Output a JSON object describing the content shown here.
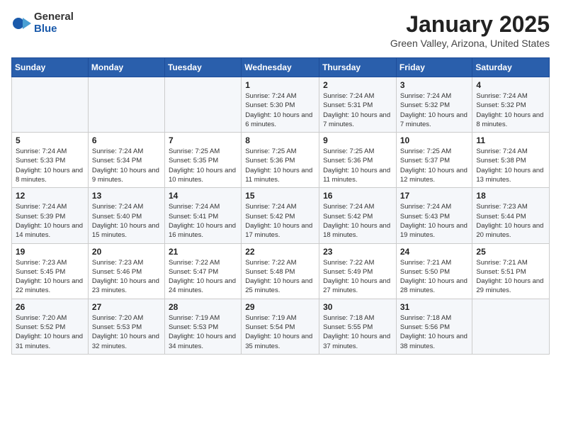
{
  "header": {
    "logo_general": "General",
    "logo_blue": "Blue",
    "title": "January 2025",
    "subtitle": "Green Valley, Arizona, United States"
  },
  "weekdays": [
    "Sunday",
    "Monday",
    "Tuesday",
    "Wednesday",
    "Thursday",
    "Friday",
    "Saturday"
  ],
  "weeks": [
    [
      {
        "day": "",
        "sunrise": "",
        "sunset": "",
        "daylight": ""
      },
      {
        "day": "",
        "sunrise": "",
        "sunset": "",
        "daylight": ""
      },
      {
        "day": "",
        "sunrise": "",
        "sunset": "",
        "daylight": ""
      },
      {
        "day": "1",
        "sunrise": "Sunrise: 7:24 AM",
        "sunset": "Sunset: 5:30 PM",
        "daylight": "Daylight: 10 hours and 6 minutes."
      },
      {
        "day": "2",
        "sunrise": "Sunrise: 7:24 AM",
        "sunset": "Sunset: 5:31 PM",
        "daylight": "Daylight: 10 hours and 7 minutes."
      },
      {
        "day": "3",
        "sunrise": "Sunrise: 7:24 AM",
        "sunset": "Sunset: 5:32 PM",
        "daylight": "Daylight: 10 hours and 7 minutes."
      },
      {
        "day": "4",
        "sunrise": "Sunrise: 7:24 AM",
        "sunset": "Sunset: 5:32 PM",
        "daylight": "Daylight: 10 hours and 8 minutes."
      }
    ],
    [
      {
        "day": "5",
        "sunrise": "Sunrise: 7:24 AM",
        "sunset": "Sunset: 5:33 PM",
        "daylight": "Daylight: 10 hours and 8 minutes."
      },
      {
        "day": "6",
        "sunrise": "Sunrise: 7:24 AM",
        "sunset": "Sunset: 5:34 PM",
        "daylight": "Daylight: 10 hours and 9 minutes."
      },
      {
        "day": "7",
        "sunrise": "Sunrise: 7:25 AM",
        "sunset": "Sunset: 5:35 PM",
        "daylight": "Daylight: 10 hours and 10 minutes."
      },
      {
        "day": "8",
        "sunrise": "Sunrise: 7:25 AM",
        "sunset": "Sunset: 5:36 PM",
        "daylight": "Daylight: 10 hours and 11 minutes."
      },
      {
        "day": "9",
        "sunrise": "Sunrise: 7:25 AM",
        "sunset": "Sunset: 5:36 PM",
        "daylight": "Daylight: 10 hours and 11 minutes."
      },
      {
        "day": "10",
        "sunrise": "Sunrise: 7:25 AM",
        "sunset": "Sunset: 5:37 PM",
        "daylight": "Daylight: 10 hours and 12 minutes."
      },
      {
        "day": "11",
        "sunrise": "Sunrise: 7:24 AM",
        "sunset": "Sunset: 5:38 PM",
        "daylight": "Daylight: 10 hours and 13 minutes."
      }
    ],
    [
      {
        "day": "12",
        "sunrise": "Sunrise: 7:24 AM",
        "sunset": "Sunset: 5:39 PM",
        "daylight": "Daylight: 10 hours and 14 minutes."
      },
      {
        "day": "13",
        "sunrise": "Sunrise: 7:24 AM",
        "sunset": "Sunset: 5:40 PM",
        "daylight": "Daylight: 10 hours and 15 minutes."
      },
      {
        "day": "14",
        "sunrise": "Sunrise: 7:24 AM",
        "sunset": "Sunset: 5:41 PM",
        "daylight": "Daylight: 10 hours and 16 minutes."
      },
      {
        "day": "15",
        "sunrise": "Sunrise: 7:24 AM",
        "sunset": "Sunset: 5:42 PM",
        "daylight": "Daylight: 10 hours and 17 minutes."
      },
      {
        "day": "16",
        "sunrise": "Sunrise: 7:24 AM",
        "sunset": "Sunset: 5:42 PM",
        "daylight": "Daylight: 10 hours and 18 minutes."
      },
      {
        "day": "17",
        "sunrise": "Sunrise: 7:24 AM",
        "sunset": "Sunset: 5:43 PM",
        "daylight": "Daylight: 10 hours and 19 minutes."
      },
      {
        "day": "18",
        "sunrise": "Sunrise: 7:23 AM",
        "sunset": "Sunset: 5:44 PM",
        "daylight": "Daylight: 10 hours and 20 minutes."
      }
    ],
    [
      {
        "day": "19",
        "sunrise": "Sunrise: 7:23 AM",
        "sunset": "Sunset: 5:45 PM",
        "daylight": "Daylight: 10 hours and 22 minutes."
      },
      {
        "day": "20",
        "sunrise": "Sunrise: 7:23 AM",
        "sunset": "Sunset: 5:46 PM",
        "daylight": "Daylight: 10 hours and 23 minutes."
      },
      {
        "day": "21",
        "sunrise": "Sunrise: 7:22 AM",
        "sunset": "Sunset: 5:47 PM",
        "daylight": "Daylight: 10 hours and 24 minutes."
      },
      {
        "day": "22",
        "sunrise": "Sunrise: 7:22 AM",
        "sunset": "Sunset: 5:48 PM",
        "daylight": "Daylight: 10 hours and 25 minutes."
      },
      {
        "day": "23",
        "sunrise": "Sunrise: 7:22 AM",
        "sunset": "Sunset: 5:49 PM",
        "daylight": "Daylight: 10 hours and 27 minutes."
      },
      {
        "day": "24",
        "sunrise": "Sunrise: 7:21 AM",
        "sunset": "Sunset: 5:50 PM",
        "daylight": "Daylight: 10 hours and 28 minutes."
      },
      {
        "day": "25",
        "sunrise": "Sunrise: 7:21 AM",
        "sunset": "Sunset: 5:51 PM",
        "daylight": "Daylight: 10 hours and 29 minutes."
      }
    ],
    [
      {
        "day": "26",
        "sunrise": "Sunrise: 7:20 AM",
        "sunset": "Sunset: 5:52 PM",
        "daylight": "Daylight: 10 hours and 31 minutes."
      },
      {
        "day": "27",
        "sunrise": "Sunrise: 7:20 AM",
        "sunset": "Sunset: 5:53 PM",
        "daylight": "Daylight: 10 hours and 32 minutes."
      },
      {
        "day": "28",
        "sunrise": "Sunrise: 7:19 AM",
        "sunset": "Sunset: 5:53 PM",
        "daylight": "Daylight: 10 hours and 34 minutes."
      },
      {
        "day": "29",
        "sunrise": "Sunrise: 7:19 AM",
        "sunset": "Sunset: 5:54 PM",
        "daylight": "Daylight: 10 hours and 35 minutes."
      },
      {
        "day": "30",
        "sunrise": "Sunrise: 7:18 AM",
        "sunset": "Sunset: 5:55 PM",
        "daylight": "Daylight: 10 hours and 37 minutes."
      },
      {
        "day": "31",
        "sunrise": "Sunrise: 7:18 AM",
        "sunset": "Sunset: 5:56 PM",
        "daylight": "Daylight: 10 hours and 38 minutes."
      },
      {
        "day": "",
        "sunrise": "",
        "sunset": "",
        "daylight": ""
      }
    ]
  ]
}
